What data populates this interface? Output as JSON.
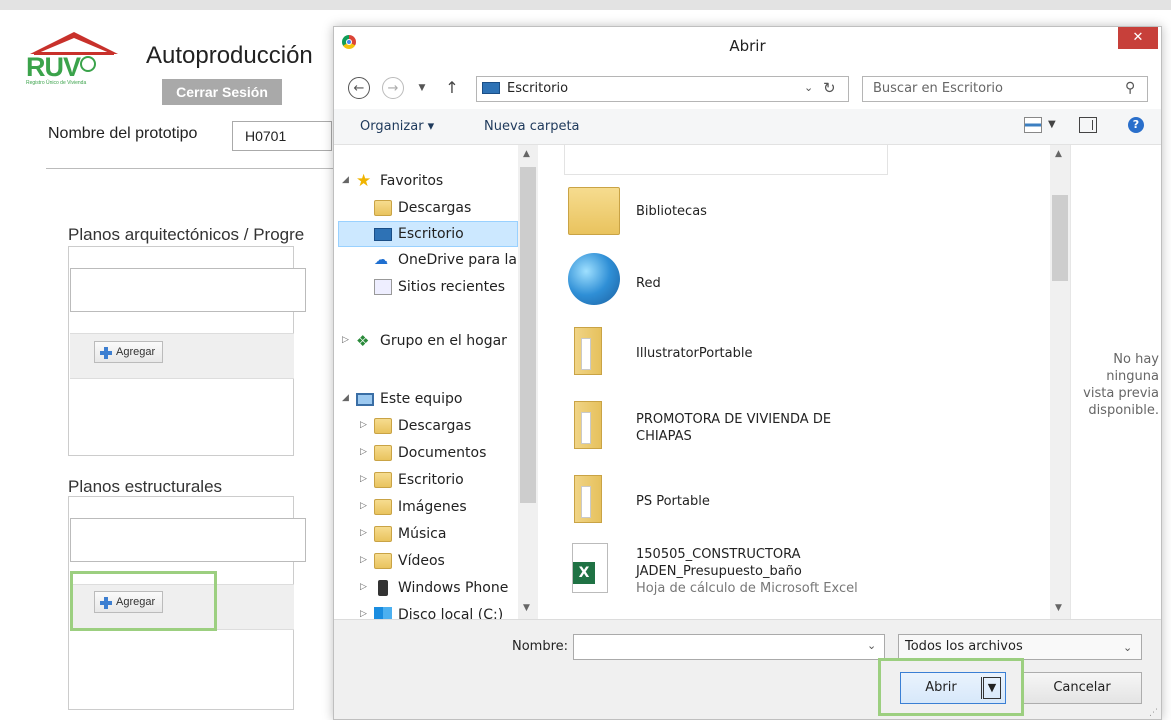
{
  "page": {
    "app_title": "Autoproducción",
    "logo_text": "RUV",
    "logo_subtitle": "Registro Único de Vivienda",
    "logout_label": "Cerrar Sesión",
    "prototype_label": "Nombre del prototipo",
    "prototype_value": "H0701",
    "sections": [
      {
        "title": "Planos arquitectónicos / Progre",
        "add_label": "Agregar"
      },
      {
        "title": "Planos estructurales",
        "add_label": "Agregar"
      }
    ]
  },
  "dialog": {
    "title": "Abrir",
    "close_label": "✕",
    "address": "Escritorio",
    "search_placeholder": "Buscar en Escritorio",
    "toolbar": {
      "organize": "Organizar ▾",
      "new_folder": "Nueva carpeta",
      "help": "?"
    },
    "nav": {
      "favorites": "Favoritos",
      "downloads": "Descargas",
      "desktop": "Escritorio",
      "onedrive": "OneDrive para la",
      "recent": "Sitios recientes",
      "homegroup": "Grupo en el hogar",
      "this_pc": "Este equipo",
      "pc_items": [
        "Descargas",
        "Documentos",
        "Escritorio",
        "Imágenes",
        "Música",
        "Vídeos",
        "Windows Phone",
        "Disco local (C:)"
      ]
    },
    "files": [
      {
        "name": "Bibliotecas",
        "icon": "libraries-icon"
      },
      {
        "name": "Red",
        "icon": "network-globe-icon"
      },
      {
        "name": "IllustratorPortable",
        "icon": "folder-icon"
      },
      {
        "name": "PROMOTORA DE VIVIENDA DE",
        "name2": "CHIAPAS",
        "icon": "folder-icon"
      },
      {
        "name": "PS Portable",
        "icon": "folder-icon"
      },
      {
        "name": "150505_CONSTRUCTORA",
        "name2": "JADEN_Presupuesto_baño",
        "type": "Hoja de cálculo de Microsoft Excel",
        "icon": "excel-icon"
      }
    ],
    "preview_text": [
      "No hay",
      "ninguna",
      "vista previa",
      "disponible."
    ],
    "filename_label": "Nombre:",
    "filename_value": "",
    "filter_value": "Todos los archivos",
    "open_label": "Abrir",
    "cancel_label": "Cancelar"
  },
  "colors": {
    "highlight_green": "#9ccf80",
    "logo_green": "#3ba34b",
    "logo_red": "#c8312b",
    "selection": "#cce8ff"
  }
}
